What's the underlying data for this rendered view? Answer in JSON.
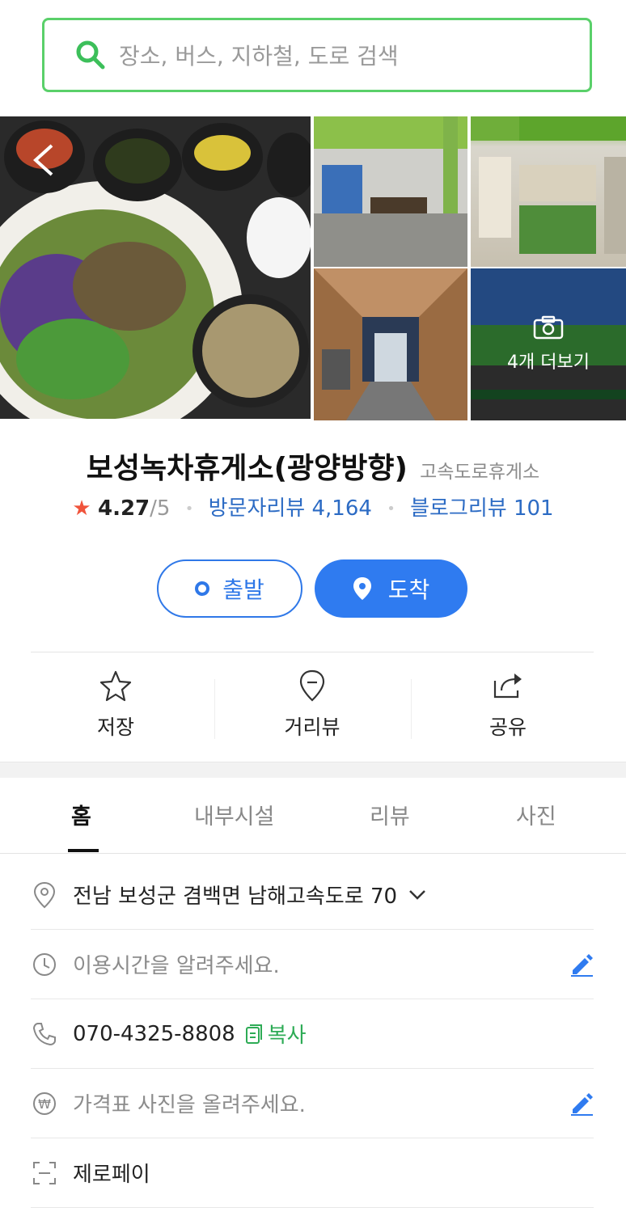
{
  "search": {
    "placeholder": "장소, 버스, 지하철, 도로 검색"
  },
  "photos": {
    "more_label": "4개 더보기"
  },
  "place": {
    "name": "보성녹차휴게소(광양방향)",
    "category": "고속도로휴게소",
    "rating": "4.27",
    "rating_max": "/5",
    "visitor_reviews": "방문자리뷰 4,164",
    "blog_reviews": "블로그리뷰 101"
  },
  "route": {
    "start_label": "출발",
    "end_label": "도착"
  },
  "actions": [
    {
      "label": "저장",
      "icon": "star-icon"
    },
    {
      "label": "거리뷰",
      "icon": "streetview-icon"
    },
    {
      "label": "공유",
      "icon": "share-icon"
    }
  ],
  "tabs": [
    "홈",
    "내부시설",
    "리뷰",
    "사진"
  ],
  "details": {
    "address": "전남 보성군 겸백면 남해고속도로 70",
    "hours": "이용시간을 알려주세요.",
    "phone": "070-4325-8808",
    "copy_label": "복사",
    "price": "가격표 사진을 올려주세요.",
    "zeropay": "제로페이"
  },
  "colors": {
    "accent_green": "#5ad06a",
    "link_blue": "#2c6bc4",
    "button_blue": "#2f7bf0"
  }
}
